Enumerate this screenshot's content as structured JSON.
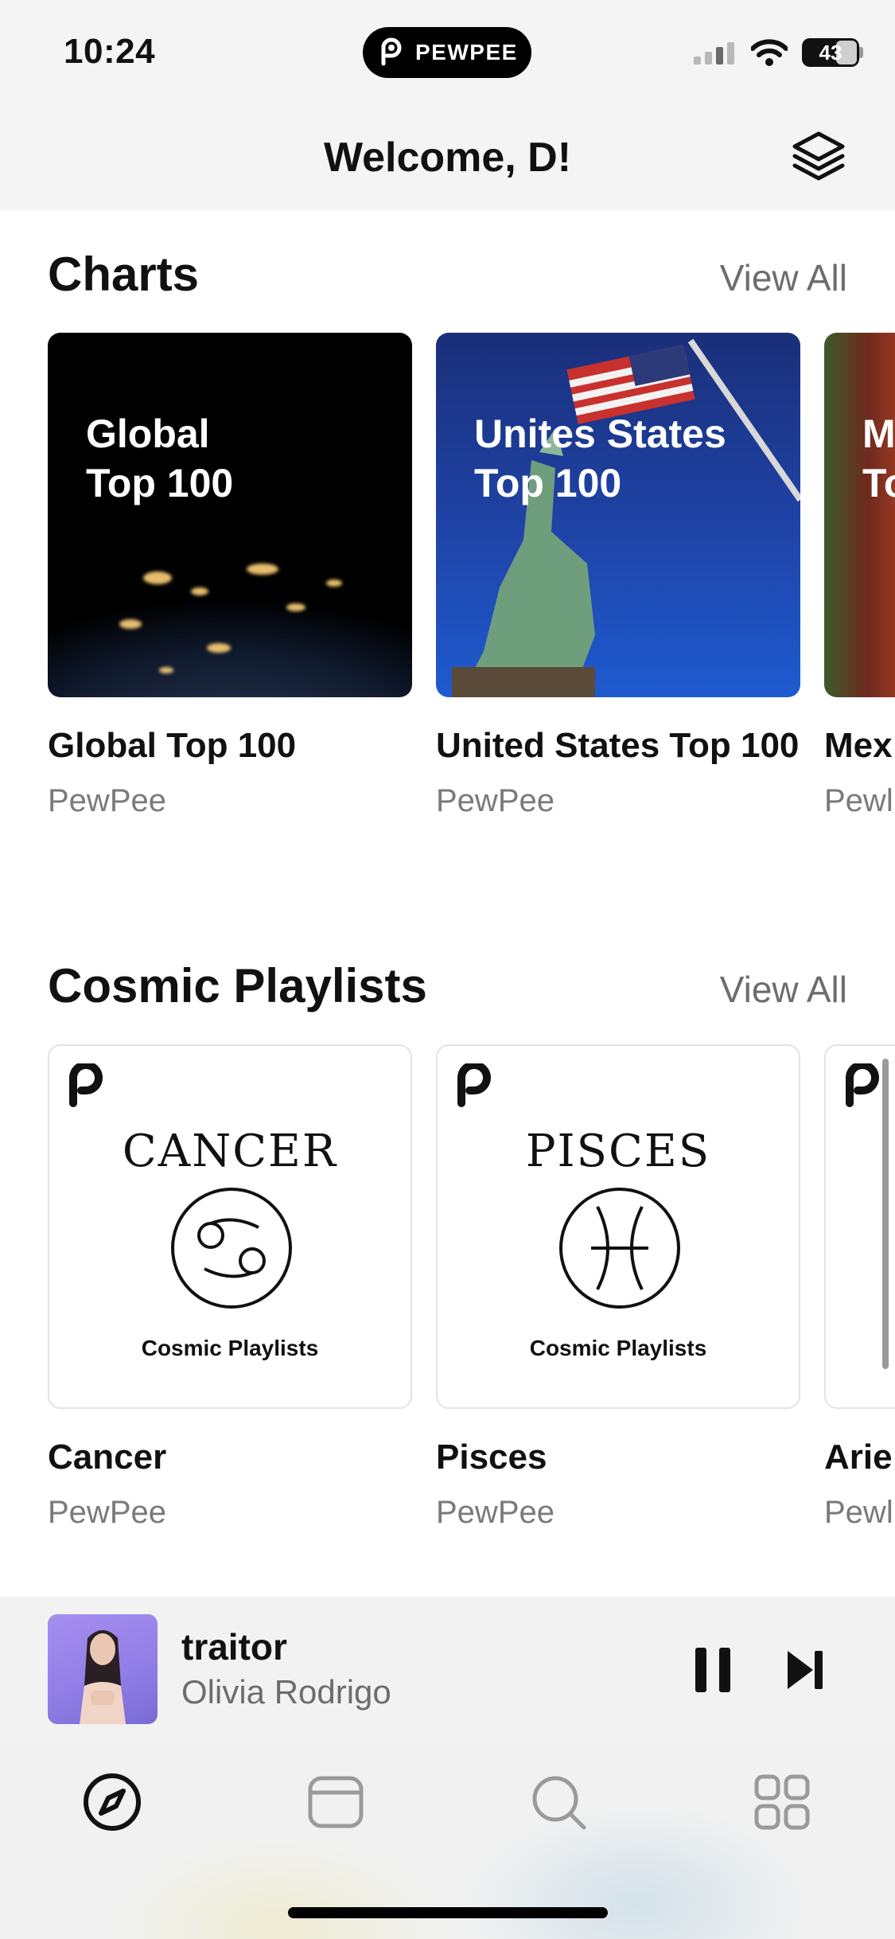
{
  "status_bar": {
    "time": "10:24",
    "island_label": "PEWPEE",
    "battery": "43"
  },
  "header": {
    "title": "Welcome, D!",
    "layers_icon": "layers-icon"
  },
  "charts": {
    "title": "Charts",
    "view_all": "View All",
    "cards": [
      {
        "art_line1": "Global",
        "art_line2": "Top 100",
        "title": "Global Top 100",
        "subtitle": "PewPee"
      },
      {
        "art_line1": "Unites States",
        "art_line2": "Top 100",
        "title": "United States Top 100",
        "subtitle": "PewPee"
      },
      {
        "art_line1": "M",
        "art_line2": "To",
        "title": "Mex",
        "subtitle": "Pewl"
      }
    ]
  },
  "cosmic": {
    "title": "Cosmic Playlists",
    "view_all": "View All",
    "cards": [
      {
        "sign": "CANCER",
        "caption": "Cosmic Playlists",
        "title": "Cancer",
        "subtitle": "PewPee"
      },
      {
        "sign": "PISCES",
        "caption": "Cosmic Playlists",
        "title": "Pisces",
        "subtitle": "PewPee"
      },
      {
        "title": "Arie",
        "subtitle": "Pewl"
      }
    ]
  },
  "player": {
    "title": "traitor",
    "artist": "Olivia Rodrigo",
    "state": "playing"
  },
  "tabs": [
    {
      "icon": "compass-icon",
      "active": true
    },
    {
      "icon": "library-icon",
      "active": false
    },
    {
      "icon": "search-icon",
      "active": false
    },
    {
      "icon": "grid-icon",
      "active": false
    }
  ],
  "colors": {
    "accent": "#111111",
    "secondary_text": "#6d6d6d",
    "inactive_tab": "#9a9a9a"
  }
}
